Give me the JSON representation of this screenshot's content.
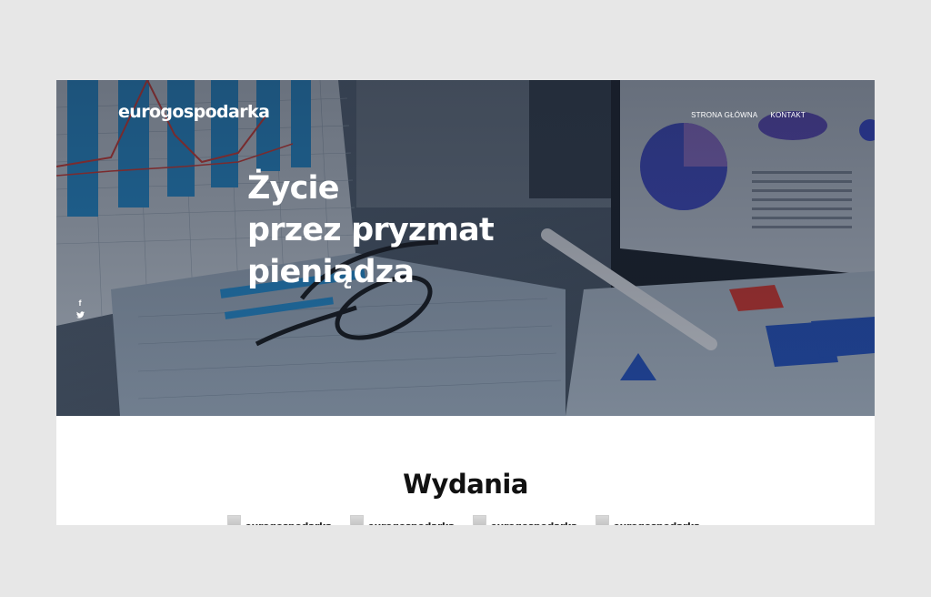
{
  "header": {
    "logo": "eurogospodarka",
    "nav": [
      {
        "label": "STRONA GŁÓWNA"
      },
      {
        "label": "KONTAKT"
      }
    ]
  },
  "hero": {
    "headline_lines": [
      "Życie",
      "przez pryzmat",
      "pieniądza"
    ],
    "social": [
      {
        "icon": "facebook-icon",
        "glyph": "f"
      },
      {
        "icon": "twitter-icon",
        "glyph": "t"
      }
    ]
  },
  "main": {
    "section_title": "Wydania",
    "issues": [
      {
        "title": "eurogospodarka"
      },
      {
        "title": "eurogospodarka"
      },
      {
        "title": "eurogospodarka"
      },
      {
        "title": "eurogospodarka"
      }
    ]
  },
  "colors": {
    "hero_overlay": "#2a3444",
    "chart_blue": "#1f8fd6",
    "text_dark": "#111111",
    "page_bg": "#e7e7e7"
  }
}
